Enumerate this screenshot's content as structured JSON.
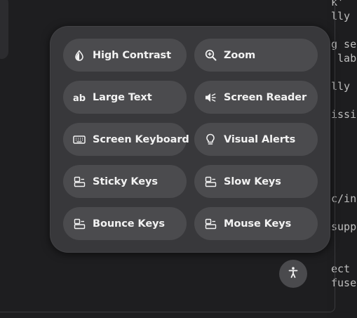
{
  "terminal_lines": [
    "k'",
    "lly",
    "",
    "g se",
    " lab",
    "",
    "lly",
    "",
    "issi",
    "",
    "",
    "",
    "",
    "c/in",
    "",
    "supp",
    "",
    "",
    "ect",
    "fuse"
  ],
  "accessibility_menu": {
    "tiles": [
      {
        "label": "High Contrast",
        "icon": "contrast-icon"
      },
      {
        "label": "Zoom",
        "icon": "zoom-icon"
      },
      {
        "label": "Large Text",
        "icon": "large-text-icon"
      },
      {
        "label": "Screen Reader",
        "icon": "screen-reader-icon"
      },
      {
        "label": "Screen Keyboard",
        "icon": "keyboard-icon"
      },
      {
        "label": "Visual Alerts",
        "icon": "lightbulb-icon"
      },
      {
        "label": "Sticky Keys",
        "icon": "keys-icon"
      },
      {
        "label": "Slow Keys",
        "icon": "keys-icon"
      },
      {
        "label": "Bounce Keys",
        "icon": "keys-icon"
      },
      {
        "label": "Mouse Keys",
        "icon": "keys-icon"
      }
    ]
  },
  "accessibility_button": {
    "icon": "accessibility-icon"
  },
  "colors": {
    "popover": "#38383b",
    "tile": "#4b4b4e",
    "text": "#f2f2f2",
    "background": "#1e1e20"
  }
}
